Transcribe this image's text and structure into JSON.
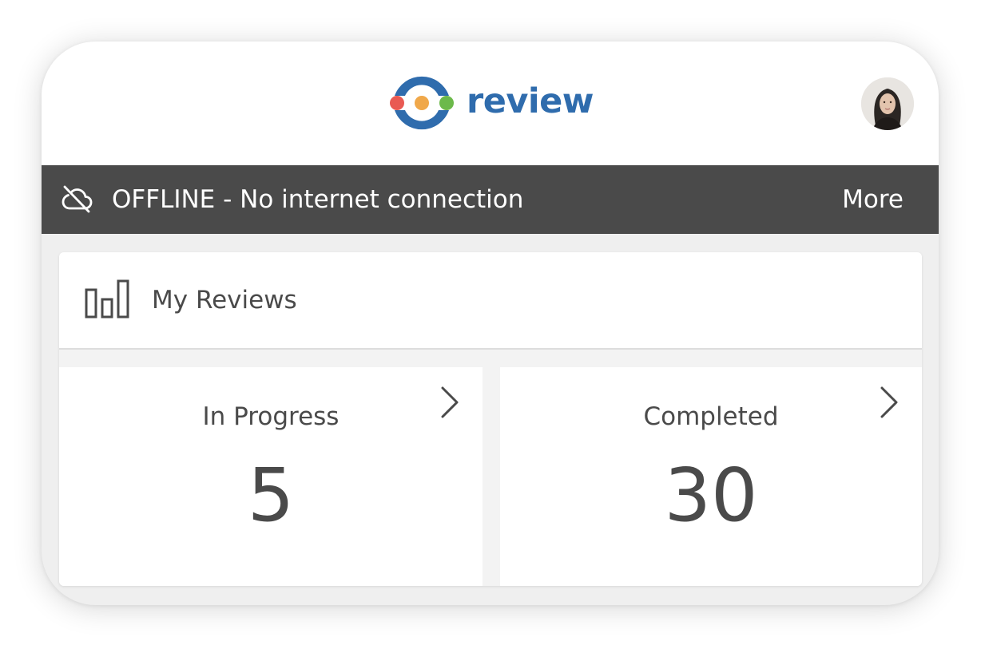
{
  "header": {
    "app_name": "review",
    "logo_icon": "review-logo-icon",
    "avatar_icon": "user-avatar",
    "colors": {
      "brand_blue": "#2f6cad",
      "dot_red": "#e95a53",
      "dot_orange": "#f0a84a",
      "dot_green": "#6cb94a"
    }
  },
  "offline_banner": {
    "icon": "cloud-off-icon",
    "message": "OFFLINE - No internet connection",
    "more_label": "More",
    "background": "#4a4a4a"
  },
  "reviews": {
    "icon": "bar-chart-icon",
    "title": "My Reviews",
    "tiles": [
      {
        "label": "In Progress",
        "count": "5",
        "icon": "chevron-right-icon"
      },
      {
        "label": "Completed",
        "count": "30",
        "icon": "chevron-right-icon"
      }
    ]
  }
}
